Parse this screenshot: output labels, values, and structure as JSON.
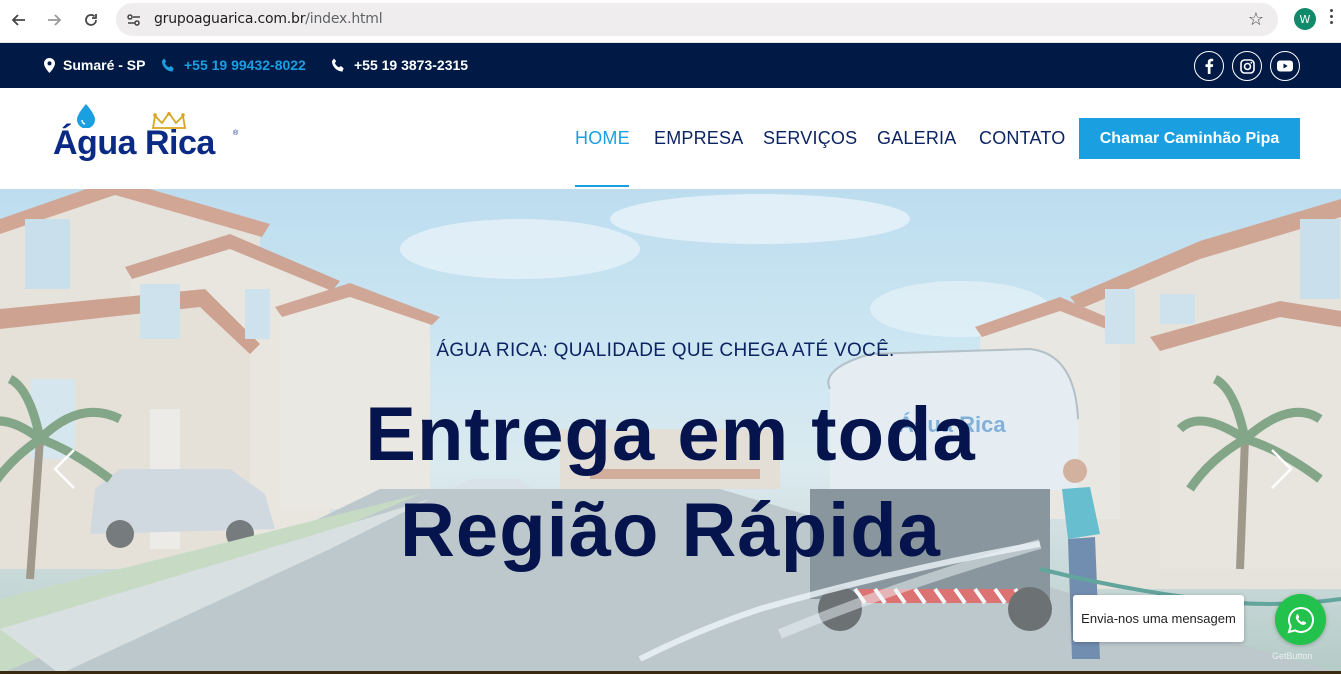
{
  "browser": {
    "url_domain": "grupoaguarica.com.br",
    "url_path": "/index.html",
    "profile_initial": "W",
    "icons": [
      "back-icon",
      "forward-icon",
      "reload-icon",
      "site-info-icon",
      "bookmark-star-icon",
      "menu-icon"
    ]
  },
  "topbar": {
    "location": "Sumaré - SP",
    "phone1": "+55 19 99432-8022",
    "phone2": "+55 19 3873-2315",
    "social": [
      "facebook-icon",
      "instagram-icon",
      "youtube-icon"
    ],
    "bg_color": "#001a45",
    "accent_color": "#1a9fe0"
  },
  "header": {
    "logo_text": "Água Rica",
    "logo_reg": "®",
    "nav": {
      "home": "HOME",
      "empresa": "EMPRESA",
      "servicos": "SERVIÇOS",
      "galeria": "GALERIA",
      "contato": "CONTATO"
    },
    "active_nav": "HOME",
    "cta_label": "Chamar Caminhão Pipa"
  },
  "hero": {
    "subtitle": "ÁGUA RICA: QUALIDADE QUE CHEGA ATÉ VOCÊ.",
    "title_line1": "Entrega em toda",
    "title_line2": "Região Rápida",
    "truck_label": "Água Rica",
    "title_color": "#06144d"
  },
  "whatsapp": {
    "bubble_text": "Envia-nos uma mensagem",
    "credit": "GetButton",
    "color": "#23c24c"
  }
}
